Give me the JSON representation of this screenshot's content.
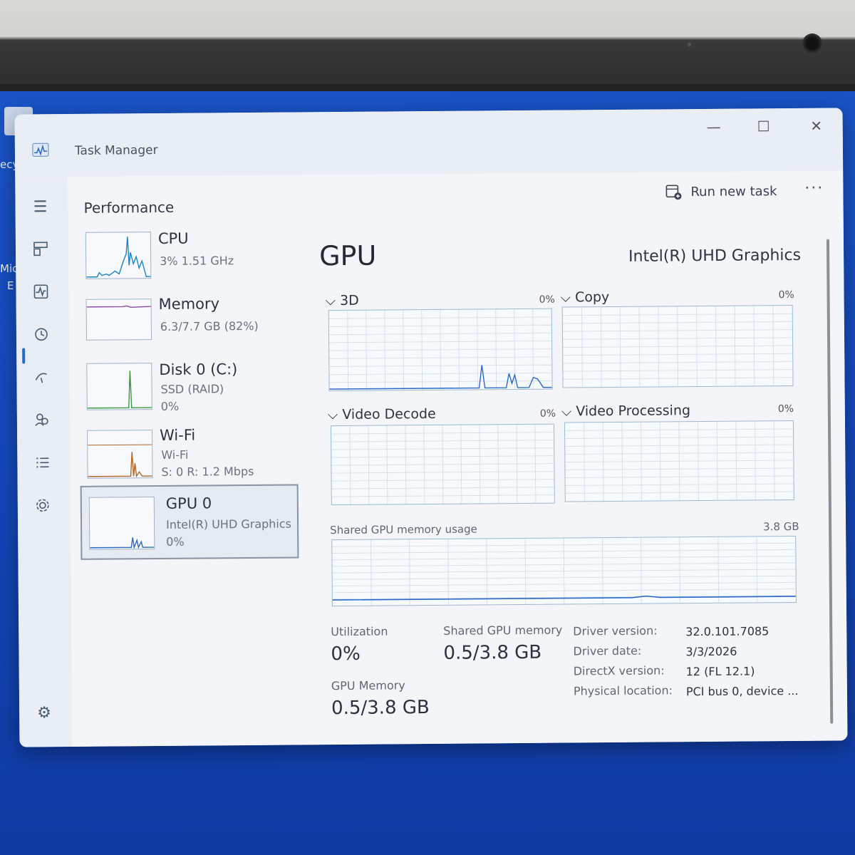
{
  "window": {
    "title": "Task Manager",
    "controls": {
      "minimize": "—",
      "maximize": "☐",
      "close": "✕"
    }
  },
  "header": {
    "page_title": "Performance",
    "run_new_task": "Run new task",
    "more": "···"
  },
  "desktop": {
    "fragment_left_1": "ecy",
    "fragment_left_2": "Mic",
    "fragment_left_3": "E"
  },
  "devices": [
    {
      "name": "CPU",
      "line1": "3%  1.51 GHz",
      "line2": ""
    },
    {
      "name": "Memory",
      "line1": "6.3/7.7 GB (82%)",
      "line2": ""
    },
    {
      "name": "Disk 0 (C:)",
      "line1": "SSD (RAID)",
      "line2": "0%"
    },
    {
      "name": "Wi-Fi",
      "line1": "Wi-Fi",
      "line2": "S: 0 R: 1.2 Mbps"
    },
    {
      "name": "GPU 0",
      "line1": "Intel(R) UHD Graphics",
      "line2": "0%"
    }
  ],
  "gpu": {
    "title": "GPU",
    "model": "Intel(R) UHD Graphics",
    "engines": [
      {
        "label": "3D",
        "pct": "0%"
      },
      {
        "label": "Copy",
        "pct": "0%"
      },
      {
        "label": "Video Decode",
        "pct": "0%"
      },
      {
        "label": "Video Processing",
        "pct": "0%"
      }
    ],
    "shared_label": "Shared GPU memory usage",
    "shared_max": "3.8 GB",
    "stats": {
      "utilization_label": "Utilization",
      "utilization_value": "0%",
      "shared_mem_label": "Shared GPU memory",
      "shared_mem_value": "0.5/3.8 GB",
      "gpu_mem_label": "GPU Memory",
      "gpu_mem_value": "0.5/3.8 GB"
    },
    "driver": [
      {
        "label": "Driver version:",
        "value": "32.0.101.7085"
      },
      {
        "label": "Driver date:",
        "value": "3/3/2026"
      },
      {
        "label": "DirectX version:",
        "value": "12 (FL 12.1)"
      },
      {
        "label": "Physical location:",
        "value": "PCI bus 0, device ..."
      }
    ]
  },
  "colors": {
    "accent": "#2a68c9",
    "cpu": "#1a82c8",
    "memory": "#8a4aa8",
    "disk": "#3f9a3f",
    "wifi": "#b0662a",
    "gpu": "#2a68c9"
  }
}
